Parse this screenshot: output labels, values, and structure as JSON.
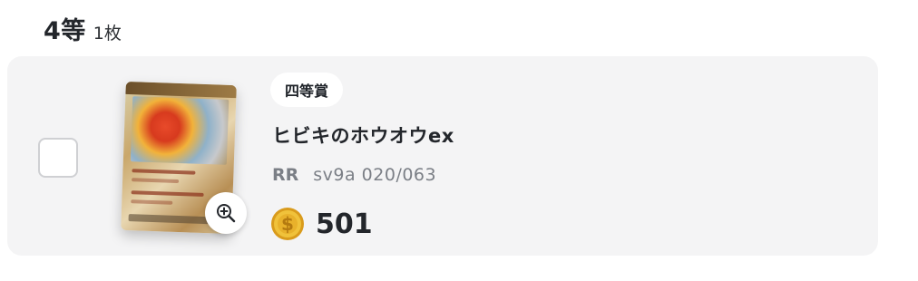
{
  "header": {
    "rank": "4等",
    "count": "1枚"
  },
  "card": {
    "prize_badge": "四等賞",
    "name": "ヒビキのホウオウex",
    "rarity": "RR",
    "set_code": "sv9a 020/063",
    "price": "501",
    "selected": false
  },
  "icons": {
    "zoom": "zoom-in-icon",
    "coin": "coin-icon"
  },
  "colors": {
    "coin": "#e8b12b",
    "card_bg": "#f4f4f5",
    "text": "#23262b",
    "muted": "#7b7f86"
  }
}
